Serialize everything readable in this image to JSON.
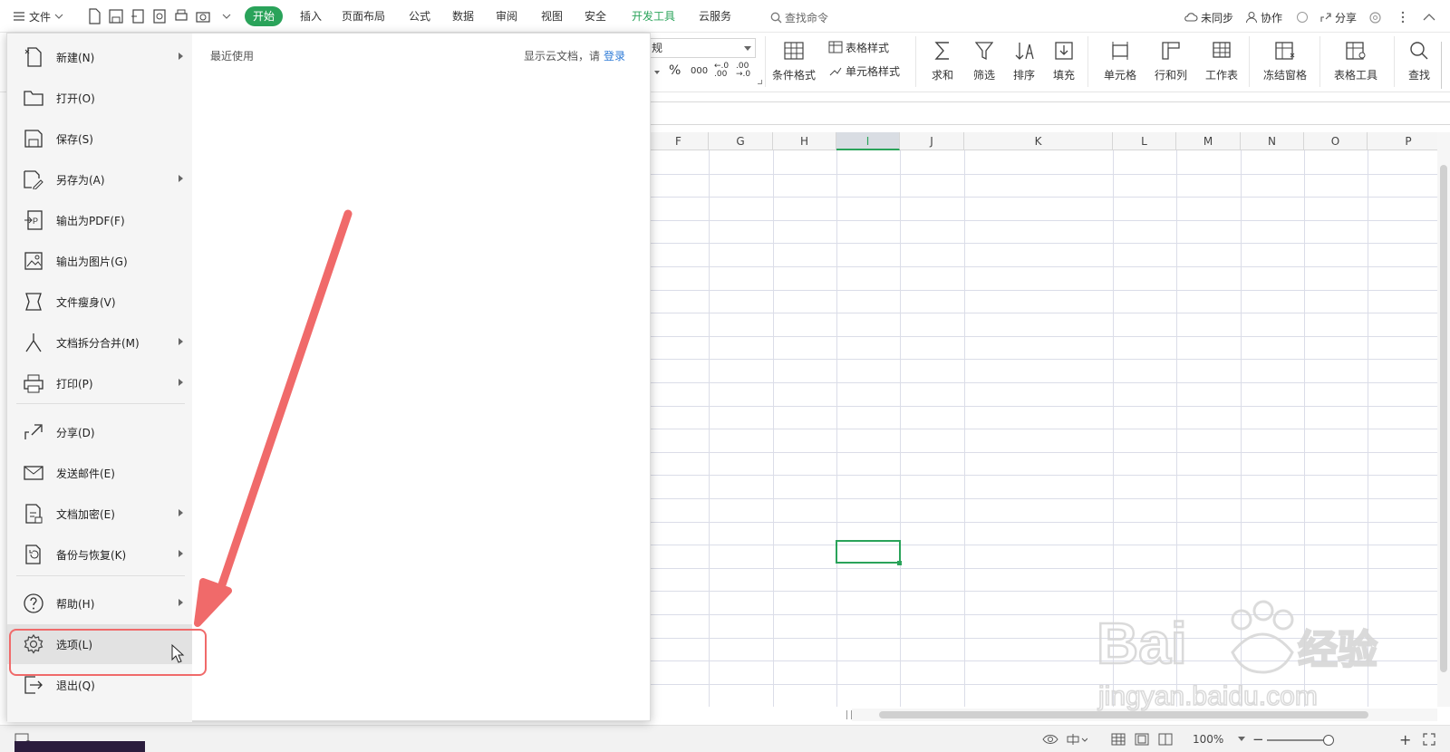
{
  "topbar": {
    "file_label": "文件",
    "tabs": [
      {
        "label": "开始",
        "active": true
      },
      {
        "label": "插入"
      },
      {
        "label": "页面布局"
      },
      {
        "label": "公式"
      },
      {
        "label": "数据"
      },
      {
        "label": "审阅"
      },
      {
        "label": "视图"
      },
      {
        "label": "安全"
      },
      {
        "label": "开发工具"
      },
      {
        "label": "云服务"
      }
    ],
    "search_label": "查找命令",
    "sync_label": "未同步",
    "collab_label": "协作",
    "share_label": "分享"
  },
  "ribbon": {
    "number_format": "规",
    "cond_format": "条件格式",
    "table_style": "表格样式",
    "cell_style": "单元格样式",
    "sum": "求和",
    "filter": "筛选",
    "sort": "排序",
    "fill": "填充",
    "cell": "单元格",
    "row_col": "行和列",
    "worksheet": "工作表",
    "freeze": "冻结窗格",
    "table_tools": "表格工具",
    "find": "查找",
    "percent": "%",
    "thousands": "000",
    "inc_dec": "←.0 .00",
    "dec_dec": ".00 →.0"
  },
  "grid": {
    "columns": [
      "F",
      "G",
      "H",
      "I",
      "J",
      "K",
      "L",
      "M",
      "N",
      "O",
      "P"
    ],
    "selected_column": "I"
  },
  "file_menu": {
    "items": [
      {
        "label": "新建(N)",
        "icon": "new-file-icon",
        "arrow": true
      },
      {
        "label": "打开(O)",
        "icon": "open-folder-icon",
        "arrow": false
      },
      {
        "label": "保存(S)",
        "icon": "save-icon",
        "arrow": false
      },
      {
        "label": "另存为(A)",
        "icon": "save-as-icon",
        "arrow": true
      },
      {
        "label": "输出为PDF(F)",
        "icon": "pdf-export-icon",
        "arrow": false
      },
      {
        "label": "输出为图片(G)",
        "icon": "image-export-icon",
        "arrow": false
      },
      {
        "label": "文件瘦身(V)",
        "icon": "slim-file-icon",
        "arrow": false
      },
      {
        "label": "文档拆分合并(M)",
        "icon": "split-merge-icon",
        "arrow": true
      },
      {
        "label": "打印(P)",
        "icon": "printer-icon",
        "arrow": true
      },
      {
        "label": "分享(D)",
        "icon": "share-icon",
        "arrow": false
      },
      {
        "label": "发送邮件(E)",
        "icon": "mail-icon",
        "arrow": false
      },
      {
        "label": "文档加密(E)",
        "icon": "encrypt-doc-icon",
        "arrow": true
      },
      {
        "label": "备份与恢复(K)",
        "icon": "backup-restore-icon",
        "arrow": true
      },
      {
        "label": "帮助(H)",
        "icon": "help-icon",
        "arrow": true
      },
      {
        "label": "选项(L)",
        "icon": "gear-icon",
        "arrow": false
      },
      {
        "label": "退出(Q)",
        "icon": "exit-icon",
        "arrow": false
      }
    ],
    "recent_title": "最近使用",
    "cloud_tip": "显示云文档，请",
    "login_label": "登录"
  },
  "statusbar": {
    "zoom": "100%",
    "zoom_minus": "−",
    "zoom_plus": "+"
  },
  "colors": {
    "accent": "#2aa35a",
    "annotation": "#f06a6a",
    "link": "#2d7ad6"
  }
}
